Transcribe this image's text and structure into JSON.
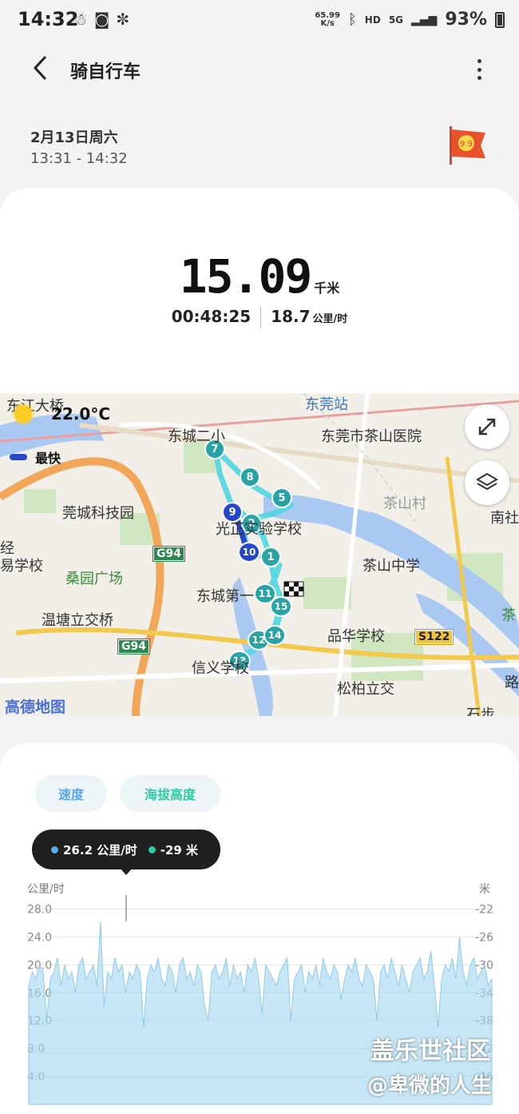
{
  "status_bar": {
    "time": "14:32",
    "net_speed_value": "65.99",
    "net_speed_unit": "K/s",
    "hd": "HD",
    "signal": "5G",
    "battery": "93%"
  },
  "app_bar": {
    "title": "骑自行车"
  },
  "session": {
    "date": "2月13日周六",
    "time_range": "13:31 - 14:32"
  },
  "summary": {
    "distance": "15.09",
    "distance_unit": "千米",
    "duration": "00:48:25",
    "speed": "18.7",
    "speed_unit": "公里/时"
  },
  "map": {
    "temperature": "22.0°C",
    "legend_fast": "最快",
    "provider": "高德地图",
    "labels": [
      "东江大桥",
      "东莞站",
      "东城二小",
      "东莞市茶山医院",
      "莞城科技园",
      "茶山村",
      "南社",
      "光正实验学校",
      "经",
      "易学校",
      "桑园广场",
      "茶山中学",
      "东城第一",
      "温塘立交桥",
      "品华学校",
      "信义学校",
      "松柏立交",
      "茶",
      "路",
      "石步"
    ],
    "road_signs": [
      "G94",
      "G94",
      "S122"
    ],
    "markers": [
      "1",
      "2",
      "5",
      "7",
      "8",
      "9",
      "10",
      "11",
      "12",
      "13",
      "14",
      "15"
    ]
  },
  "tabs": {
    "speed": "速度",
    "altitude": "海拔高度"
  },
  "tooltip": {
    "speed": "26.2 公里/时",
    "altitude": "-29 米"
  },
  "colors": {
    "speed": "#5aa8e6",
    "altitude": "#30c9a4",
    "route": "#4fd6e0",
    "route_fast": "#2547c9"
  },
  "chart_data": {
    "type": "area",
    "y_left_label": "公里/时",
    "y_right_label": "米",
    "y_left_ticks": [
      "28.0",
      "24.0",
      "20.0",
      "16.0",
      "12.0",
      "8.0",
      "4.0"
    ],
    "y_right_ticks": [
      "-22",
      "-26",
      "-30",
      "-34",
      "-38",
      "-42",
      "-46"
    ],
    "ylim_left": [
      0,
      30
    ],
    "series": [
      {
        "name": "速度",
        "values": [
          17,
          19,
          18,
          20,
          19,
          12,
          18,
          19,
          21,
          17,
          20,
          18,
          19,
          16,
          20,
          21,
          18,
          19,
          20,
          17,
          26.2,
          14,
          19,
          18,
          21,
          19,
          20,
          16,
          19,
          18,
          20,
          19,
          11,
          18,
          20,
          19,
          21,
          18,
          17,
          20,
          19,
          16,
          20,
          21,
          18,
          19,
          17,
          20,
          19,
          14,
          12,
          19,
          20,
          18,
          19,
          21,
          17,
          20,
          18,
          19,
          16,
          20,
          19,
          21,
          18,
          13,
          20,
          19,
          18,
          17,
          19,
          20,
          21,
          12,
          18,
          19,
          20,
          16,
          19,
          18,
          20,
          17,
          21,
          19,
          18,
          20,
          19,
          15,
          18,
          20,
          19,
          21,
          18,
          17,
          20,
          19,
          18,
          12,
          19,
          20,
          18,
          21,
          19,
          17,
          20,
          18,
          16,
          19,
          20,
          21,
          18,
          19,
          22,
          17,
          11,
          18,
          20,
          19,
          21,
          18,
          24,
          19,
          17,
          20,
          21,
          18,
          19,
          20,
          17,
          18
        ]
      }
    ]
  },
  "watermark": {
    "line1": "盖乐世社区",
    "line2": "@卑微的人生"
  }
}
